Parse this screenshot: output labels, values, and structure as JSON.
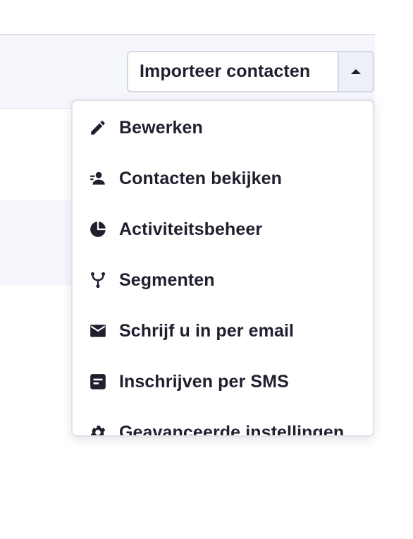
{
  "import_button": {
    "label": "Importeer contacten",
    "toggle_icon": "caret-up-icon"
  },
  "menu": {
    "items": [
      {
        "label": "Bewerken",
        "icon": "pencil-icon"
      },
      {
        "label": "Contacten bekijken",
        "icon": "contacts-icon"
      },
      {
        "label": "Activiteitsbeheer",
        "icon": "pie-chart-icon"
      },
      {
        "label": "Segmenten",
        "icon": "segments-icon"
      },
      {
        "label": "Schrijf u in per email",
        "icon": "envelope-icon"
      },
      {
        "label": "Inschrijven per SMS",
        "icon": "sms-form-icon"
      },
      {
        "label": "Geavanceerde instellingen",
        "icon": "gear-icon"
      }
    ]
  },
  "colors": {
    "text": "#1f1f2e",
    "band_background": "#f6f7fc",
    "toggle_background": "#eef0f8",
    "border": "#d4d8e4"
  }
}
